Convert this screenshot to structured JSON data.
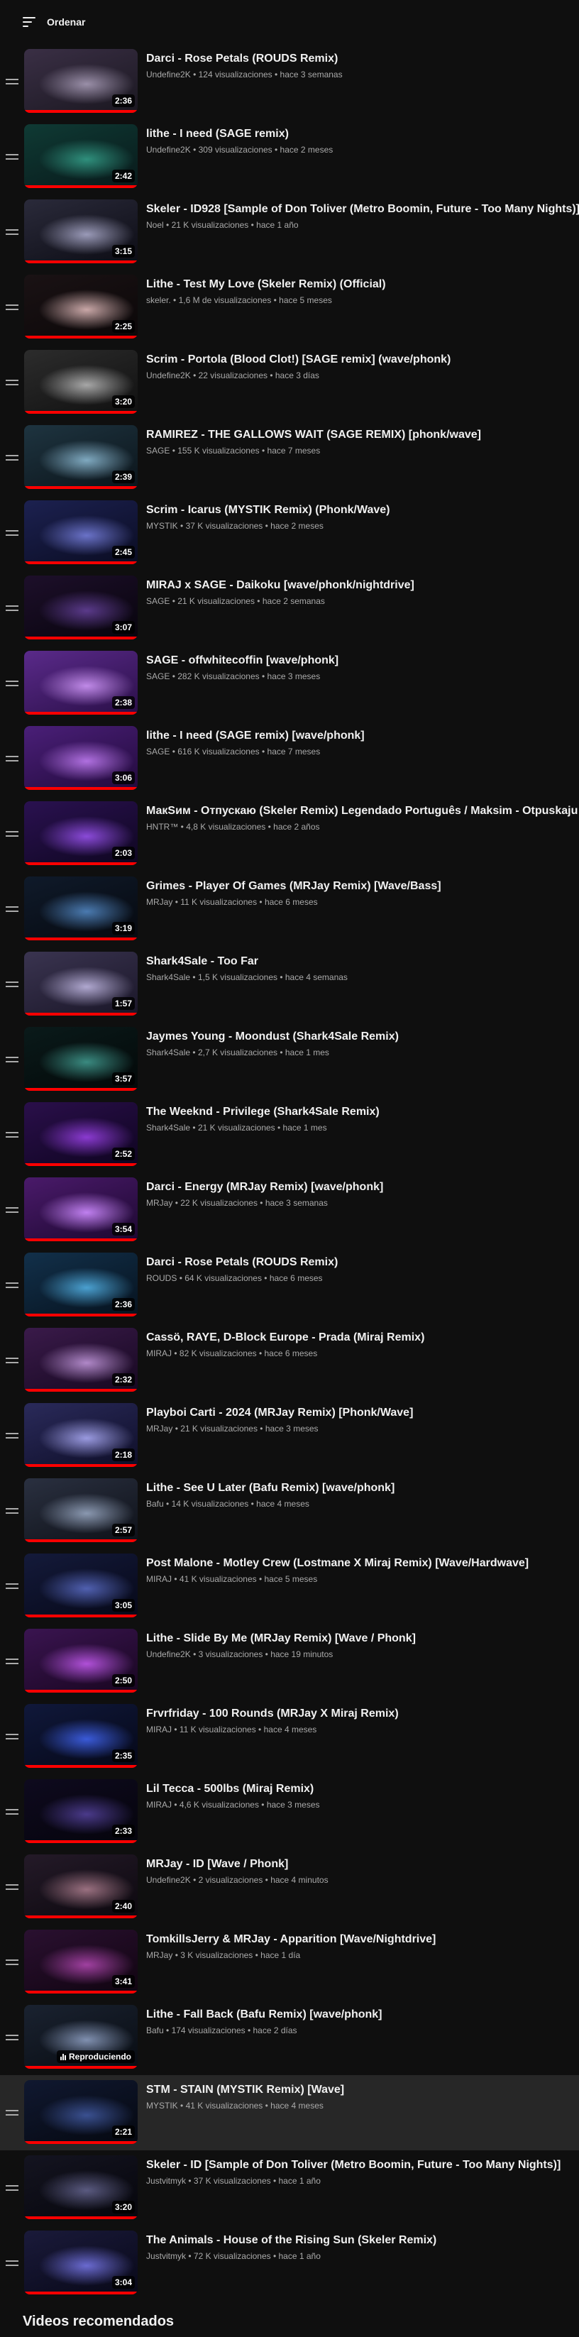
{
  "header": {
    "sort_label": "Ordenar"
  },
  "section_title": "Videos recomendados",
  "playing_label": "Reproduciendo",
  "videos": [
    {
      "title": "Darci - Rose Petals (ROUDS Remix)",
      "channel": "Undefine2K",
      "stats": "124 visualizaciones • hace 3 semanas",
      "duration": "2:36",
      "colors": [
        "#3a2f45",
        "#9a8fa8",
        "#1a1720"
      ]
    },
    {
      "title": "lithe - I need (SAGE remix)",
      "channel": "Undefine2K",
      "stats": "309 visualizaciones • hace 2 meses",
      "duration": "2:42",
      "colors": [
        "#0f3a34",
        "#2f8f7c",
        "#08191a"
      ]
    },
    {
      "title": "Skeler - ID928 [Sample of Don Toliver (Metro Boomin, Future - Too Many Nights)]",
      "channel": "Noel",
      "stats": "21 K visualizaciones • hace 1 año",
      "duration": "3:15",
      "colors": [
        "#2a2a3a",
        "#9a9ab8",
        "#0c0c14"
      ]
    },
    {
      "title": "Lithe - Test My Love (Skeler Remix) (Official)",
      "channel": "skeler.",
      "stats": "1,6 M de visualizaciones • hace 5 meses",
      "duration": "2:25",
      "colors": [
        "#1a1214",
        "#c9a7a7",
        "#0b0708"
      ]
    },
    {
      "title": "Scrim - Portola (Blood Clot!) [SAGE remix] (wave/phonk)",
      "channel": "Undefine2K",
      "stats": "22 visualizaciones • hace 3 días",
      "duration": "3:20",
      "colors": [
        "#2c2c2c",
        "#a7a7a7",
        "#101010"
      ]
    },
    {
      "title": "RAMIREZ - THE GALLOWS WAIT (SAGE REMIX) [phonk/wave]",
      "channel": "SAGE",
      "stats": "155 K visualizaciones • hace 7 meses",
      "duration": "2:39",
      "colors": [
        "#1e3440",
        "#7fa9c0",
        "#0b141a"
      ]
    },
    {
      "title": "Scrim - Icarus (MYSTIK Remix) (Phonk/Wave)",
      "channel": "MYSTIK",
      "stats": "37 K visualizaciones • hace 2 meses",
      "duration": "2:45",
      "colors": [
        "#1c2150",
        "#6a72c8",
        "#0a0c22"
      ]
    },
    {
      "title": "MIRAJ x SAGE - Daikoku [wave/phonk/nightdrive]",
      "channel": "SAGE",
      "stats": "21 K visualizaciones • hace 2 semanas",
      "duration": "3:07",
      "colors": [
        "#1d0f2a",
        "#5a3a8a",
        "#07040c"
      ]
    },
    {
      "title": "SAGE - offwhitecoffin [wave/phonk]",
      "channel": "SAGE",
      "stats": "282 K visualizaciones • hace 3 meses",
      "duration": "2:38",
      "colors": [
        "#5a2a8a",
        "#c08ae8",
        "#2a0f48"
      ]
    },
    {
      "title": "lithe - I need (SAGE remix) [wave/phonk]",
      "channel": "SAGE",
      "stats": "616 K visualizaciones • hace 7 meses",
      "duration": "3:06",
      "colors": [
        "#4a1f78",
        "#b070e0",
        "#220a3c"
      ]
    },
    {
      "title": "МакЅим - Отпускаю (Skeler Remix) Legendado Português / Maksim - Otpuskaju Letra",
      "channel": "HNTR™",
      "stats": "4,8 K visualizaciones • hace 2 años",
      "duration": "2:03",
      "colors": [
        "#2a1150",
        "#8a4ad8",
        "#0e0620"
      ]
    },
    {
      "title": "Grimes - Player Of Games (MRJay Remix) [Wave/Bass]",
      "channel": "MRJay",
      "stats": "11 K visualizaciones • hace 6 meses",
      "duration": "3:19",
      "colors": [
        "#0f1a2a",
        "#4a7ab0",
        "#06090f"
      ]
    },
    {
      "title": "Shark4Sale - Too Far",
      "channel": "Shark4Sale",
      "stats": "1,5 K visualizaciones • hace 4 semanas",
      "duration": "1:57",
      "colors": [
        "#3a3450",
        "#b0a8d0",
        "#1a1628"
      ]
    },
    {
      "title": "Jaymes Young - Moondust (Shark4Sale Remix)",
      "channel": "Shark4Sale",
      "stats": "2,7 K visualizaciones • hace 1 mes",
      "duration": "3:57",
      "colors": [
        "#0a1a1a",
        "#3a8a80",
        "#030808"
      ]
    },
    {
      "title": "The Weeknd - Privilege (Shark4Sale Remix)",
      "channel": "Shark4Sale",
      "stats": "21 K visualizaciones • hace 1 mes",
      "duration": "2:52",
      "colors": [
        "#2a0f4a",
        "#8a3ad0",
        "#0e0420"
      ]
    },
    {
      "title": "Darci - Energy (MRJay Remix) [wave/phonk]",
      "channel": "MRJay",
      "stats": "22 K visualizaciones • hace 3 semanas",
      "duration": "3:54",
      "colors": [
        "#4a1a6a",
        "#c080f0",
        "#1c0830"
      ]
    },
    {
      "title": "Darci - Rose Petals (ROUDS Remix)",
      "channel": "ROUDS",
      "stats": "64 K visualizaciones • hace 6 meses",
      "duration": "2:36",
      "colors": [
        "#12304a",
        "#4aa0d0",
        "#06121e"
      ]
    },
    {
      "title": "Cassö, RAYE, D-Block Europe - Prada (Miraj Remix)",
      "channel": "MIRAJ",
      "stats": "82 K visualizaciones • hace 6 meses",
      "duration": "2:32",
      "colors": [
        "#3a1a4a",
        "#b088c8",
        "#160820"
      ]
    },
    {
      "title": "Playboi Carti - 2024 (MRJay Remix) [Phonk/Wave]",
      "channel": "MRJay",
      "stats": "21 K visualizaciones • hace 3 meses",
      "duration": "2:18",
      "colors": [
        "#2a2a5a",
        "#9a9ae0",
        "#0e0e28"
      ]
    },
    {
      "title": "Lithe - See U Later (Bafu Remix) [wave/phonk]",
      "channel": "Bafu",
      "stats": "14 K visualizaciones • hace 4 meses",
      "duration": "2:57",
      "colors": [
        "#2a3040",
        "#8a98b0",
        "#0e1118"
      ]
    },
    {
      "title": "Post Malone - Motley Crew (Lostmane X Miraj Remix) [Wave/Hardwave]",
      "channel": "MIRAJ",
      "stats": "41 K visualizaciones • hace 5 meses",
      "duration": "3:05",
      "colors": [
        "#141a3a",
        "#5060b0",
        "#060818"
      ]
    },
    {
      "title": "Lithe - Slide By Me (MRJay Remix) [Wave / Phonk]",
      "channel": "Undefine2K",
      "stats": "3 visualizaciones • hace 19 minutos",
      "duration": "2:50",
      "colors": [
        "#3a1450",
        "#b050d8",
        "#180620"
      ]
    },
    {
      "title": "Frvrfriday - 100 Rounds (MRJay X Miraj Remix)",
      "channel": "MIRAJ",
      "stats": "11 K visualizaciones • hace 4 meses",
      "duration": "2:35",
      "colors": [
        "#10183a",
        "#3a5ad8",
        "#050818"
      ]
    },
    {
      "title": "Lil Tecca - 500lbs (Miraj Remix)",
      "channel": "MIRAJ",
      "stats": "4,6 K visualizaciones • hace 3 meses",
      "duration": "2:33",
      "colors": [
        "#0e0a1e",
        "#4a3a8a",
        "#05040c"
      ]
    },
    {
      "title": "MRJay - ID [Wave / Phonk]",
      "channel": "Undefine2K",
      "stats": "2 visualizaciones • hace 4 minutos",
      "duration": "2:40",
      "colors": [
        "#241a28",
        "#9a7080",
        "#0c080e"
      ]
    },
    {
      "title": "TomkillsJerry & MRJay - Apparition [Wave/Nightdrive]",
      "channel": "MRJay",
      "stats": "3 K visualizaciones • hace 1 día",
      "duration": "3:41",
      "colors": [
        "#2a1030",
        "#a040a0",
        "#100410"
      ]
    },
    {
      "title": "Lithe - Fall Back (Bafu Remix) [wave/phonk]",
      "channel": "Bafu",
      "stats": "174 visualizaciones • hace 2 días",
      "duration": "",
      "playing": true,
      "colors": [
        "#1a2230",
        "#8090b0",
        "#080c12"
      ]
    },
    {
      "title": "STM - STAIN (MYSTIK Remix) [Wave]",
      "channel": "MYSTIK",
      "stats": "41 K visualizaciones • hace 4 meses",
      "duration": "2:21",
      "active": true,
      "colors": [
        "#101830",
        "#3a5090",
        "#050810"
      ]
    },
    {
      "title": "Skeler - ID [Sample of Don Toliver (Metro Boomin, Future - Too Many Nights)]",
      "channel": "Justvitmyk",
      "stats": "37 K visualizaciones • hace 1 año",
      "duration": "3:20",
      "colors": [
        "#141420",
        "#5a5a80",
        "#06060c"
      ]
    },
    {
      "title": "The Animals - House of the Rising Sun (Skeler Remix)",
      "channel": "Justvitmyk",
      "stats": "72 K visualizaciones • hace 1 año",
      "duration": "3:04",
      "colors": [
        "#1a1a3a",
        "#6a6ad0",
        "#080818"
      ]
    }
  ]
}
